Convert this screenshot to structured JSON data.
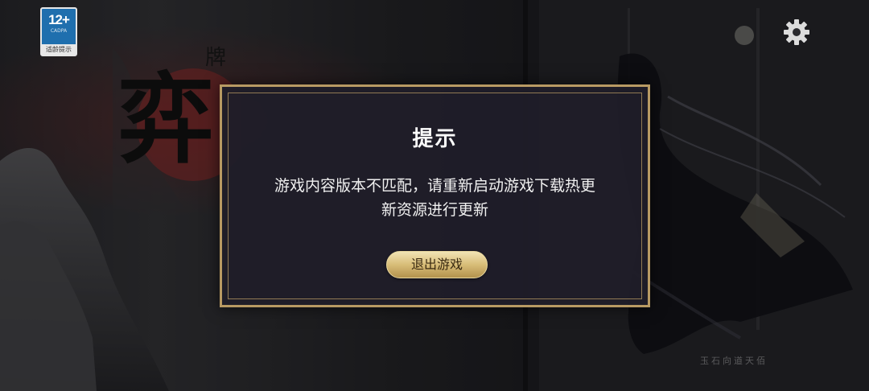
{
  "badge": {
    "age": "12+",
    "caption": "CADPA",
    "label": "适龄提示"
  },
  "logo": {
    "text": "弈",
    "sub_text": "牌"
  },
  "settings": {
    "icon": "gear-icon"
  },
  "dialog": {
    "title": "提示",
    "message_line1": "游戏内容版本不匹配，请重新启动游戏下载热更",
    "message_line2": "新资源进行更新",
    "button_label": "退出游戏"
  },
  "signature": "玉石向道天佰",
  "colors": {
    "dialog_bg": "#1f1d29",
    "dialog_border": "#b89a63",
    "button_gold": "#d8bd78"
  }
}
